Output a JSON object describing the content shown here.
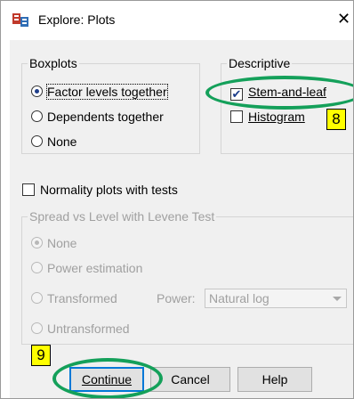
{
  "window": {
    "title": "Explore: Plots",
    "close_glyph": "✕",
    "icon_name": "spss-explore-icon"
  },
  "boxplots": {
    "legend": "Boxplots",
    "options": [
      {
        "label": "Factor levels together",
        "selected": true
      },
      {
        "label": "Dependents together",
        "selected": false
      },
      {
        "label": "None",
        "selected": false
      }
    ]
  },
  "descriptive": {
    "legend": "Descriptive",
    "stem_and_leaf": {
      "label": "Stem-and-leaf",
      "checked": true
    },
    "histogram": {
      "label": "Histogram",
      "checked": false
    }
  },
  "normality": {
    "label": "Normality plots with tests",
    "checked": false
  },
  "spread": {
    "legend": "Spread vs Level with Levene Test",
    "options": [
      {
        "label": "None",
        "selected": true
      },
      {
        "label": "Power estimation",
        "selected": false
      },
      {
        "label": "Transformed",
        "selected": false
      },
      {
        "label": "Untransformed",
        "selected": false
      }
    ],
    "power_label": "Power:",
    "power_value": "Natural log"
  },
  "buttons": {
    "continue": "Continue",
    "cancel": "Cancel",
    "help": "Help"
  },
  "annotations": {
    "callout_8": "8",
    "callout_9": "9",
    "highlight_color": "#14a05a",
    "callout_color": "#ffff00"
  }
}
